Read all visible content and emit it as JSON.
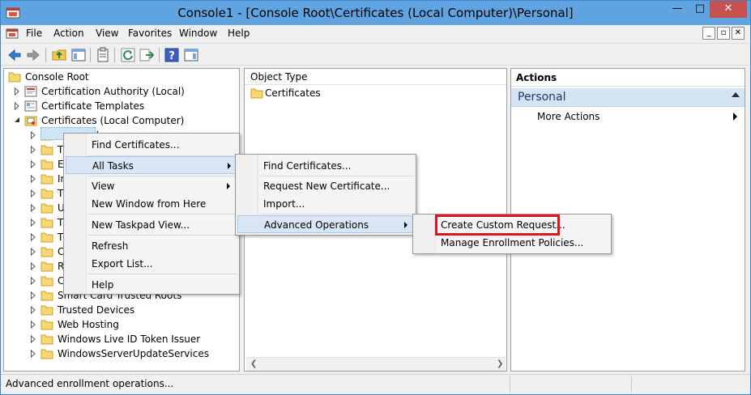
{
  "window": {
    "title": "Console1 - [Console Root\\Certificates (Local Computer)\\Personal]",
    "minimize_glyph": "—",
    "maximize_glyph": "□",
    "close_glyph": "✕"
  },
  "menubar": {
    "items": [
      "File",
      "Action",
      "View",
      "Favorites",
      "Window",
      "Help"
    ],
    "mdi_min": "_",
    "mdi_restore": "▫",
    "mdi_close": "✕"
  },
  "tree": {
    "items": [
      {
        "label": "Console Root",
        "icon": "folder-icon",
        "indent": 0,
        "expander": ""
      },
      {
        "label": "Certification Authority (Local)",
        "icon": "certificate-authority-icon",
        "indent": 1,
        "expander": "collapsed"
      },
      {
        "label": "Certificate Templates",
        "icon": "certificate-templates-icon",
        "indent": 1,
        "expander": "collapsed"
      },
      {
        "label": "Certificates (Local Computer)",
        "icon": "certificates-store-icon",
        "indent": 1,
        "expander": "expanded"
      },
      {
        "label": "Personal",
        "icon": "folder-icon",
        "indent": 2,
        "expander": "collapsed"
      },
      {
        "label": "T",
        "icon": "folder-icon",
        "indent": 2,
        "expander": "collapsed"
      },
      {
        "label": "E",
        "icon": "folder-icon",
        "indent": 2,
        "expander": "collapsed"
      },
      {
        "label": "In",
        "icon": "folder-icon",
        "indent": 2,
        "expander": "collapsed"
      },
      {
        "label": "T",
        "icon": "folder-icon",
        "indent": 2,
        "expander": "collapsed"
      },
      {
        "label": "U",
        "icon": "folder-icon",
        "indent": 2,
        "expander": "collapsed"
      },
      {
        "label": "T",
        "icon": "folder-icon",
        "indent": 2,
        "expander": "collapsed"
      },
      {
        "label": "T",
        "icon": "folder-icon",
        "indent": 2,
        "expander": "collapsed"
      },
      {
        "label": "C",
        "icon": "folder-icon",
        "indent": 2,
        "expander": "collapsed"
      },
      {
        "label": "R",
        "icon": "folder-icon",
        "indent": 2,
        "expander": "collapsed"
      },
      {
        "label": "C",
        "icon": "folder-icon",
        "indent": 2,
        "expander": "collapsed"
      },
      {
        "label": "Smart Card Trusted Roots",
        "icon": "folder-icon",
        "indent": 2,
        "expander": "collapsed"
      },
      {
        "label": "Trusted Devices",
        "icon": "folder-icon",
        "indent": 2,
        "expander": "collapsed"
      },
      {
        "label": "Web Hosting",
        "icon": "folder-icon",
        "indent": 2,
        "expander": "collapsed"
      },
      {
        "label": "Windows Live ID Token Issuer",
        "icon": "folder-icon",
        "indent": 2,
        "expander": "collapsed"
      },
      {
        "label": "WindowsServerUpdateServices",
        "icon": "folder-icon",
        "indent": 2,
        "expander": "collapsed"
      }
    ]
  },
  "list": {
    "header": "Object Type",
    "rows": [
      "Certificates"
    ]
  },
  "actions": {
    "header": "Actions",
    "section": "Personal",
    "more_actions": "More Actions"
  },
  "context_menu": {
    "items": [
      "Find Certificates...",
      "All Tasks",
      "View",
      "New Window from Here",
      "New Taskpad View...",
      "Refresh",
      "Export List...",
      "Help"
    ]
  },
  "all_tasks_menu": {
    "items": [
      "Find Certificates...",
      "Request New Certificate...",
      "Import...",
      "Advanced Operations"
    ]
  },
  "advanced_menu": {
    "items": [
      "Create Custom Request...",
      "Manage Enrollment Policies..."
    ]
  },
  "statusbar": {
    "text": "Advanced enrollment operations..."
  },
  "colors": {
    "titlebar": "#5fa3e0",
    "highlight_box": "#e0161e",
    "selection": "#d8e6f5"
  }
}
